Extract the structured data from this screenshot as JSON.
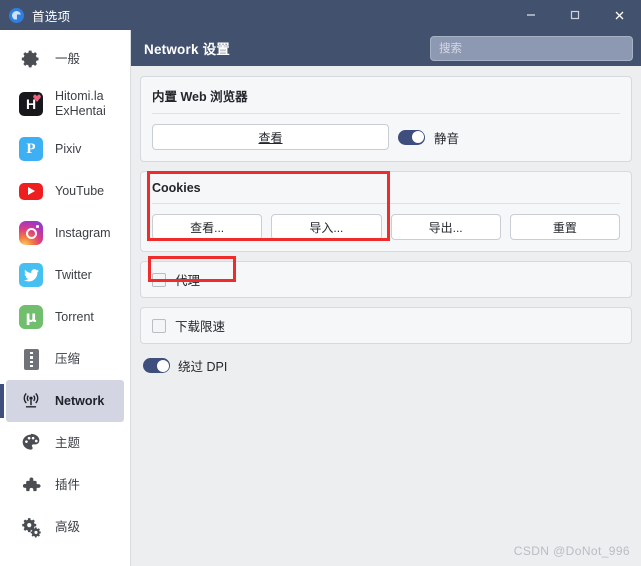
{
  "window": {
    "title": "首选项",
    "icon": "app-circle-icon",
    "controls": {
      "minimize": "minimize-icon",
      "maximize": "maximize-icon",
      "close": "close-icon"
    }
  },
  "sidebar": {
    "items": [
      {
        "label": "一般",
        "icon": "gear-icon",
        "selected": false
      },
      {
        "label": "Hitomi.la ExHentai",
        "icon": "hitomi-icon",
        "selected": false
      },
      {
        "label": "Pixiv",
        "icon": "pixiv-icon",
        "selected": false
      },
      {
        "label": "YouTube",
        "icon": "youtube-icon",
        "selected": false
      },
      {
        "label": "Instagram",
        "icon": "instagram-icon",
        "selected": false
      },
      {
        "label": "Twitter",
        "icon": "twitter-icon",
        "selected": false
      },
      {
        "label": "Torrent",
        "icon": "torrent-icon",
        "selected": false
      },
      {
        "label": "压缩",
        "icon": "zip-icon",
        "selected": false
      },
      {
        "label": "Network",
        "icon": "network-signal-icon",
        "selected": true
      },
      {
        "label": "主题",
        "icon": "palette-icon",
        "selected": false
      },
      {
        "label": "插件",
        "icon": "puzzle-piece-icon",
        "selected": false
      },
      {
        "label": "高级",
        "icon": "gears-icon",
        "selected": false
      }
    ]
  },
  "header": {
    "title": "Network 设置",
    "search_placeholder": "搜索",
    "search_value": ""
  },
  "sections": {
    "browser": {
      "title": "内置 Web 浏览器",
      "view_button": "查看",
      "mute_toggle": {
        "label": "静音",
        "on": true
      }
    },
    "cookies": {
      "title": "Cookies",
      "buttons": [
        "查看...",
        "导入...",
        "导出...",
        "重置"
      ]
    },
    "proxy": {
      "label": "代理",
      "checked": false
    },
    "speed_limit": {
      "label": "下载限速",
      "checked": false
    },
    "bypass_dpi": {
      "label": "绕过 DPI",
      "on": true
    }
  },
  "annotations": {
    "color": "#EF2B2B",
    "boxes": [
      "cookies-highlight",
      "proxy-highlight"
    ]
  },
  "watermark": "CSDN @DoNot_996"
}
